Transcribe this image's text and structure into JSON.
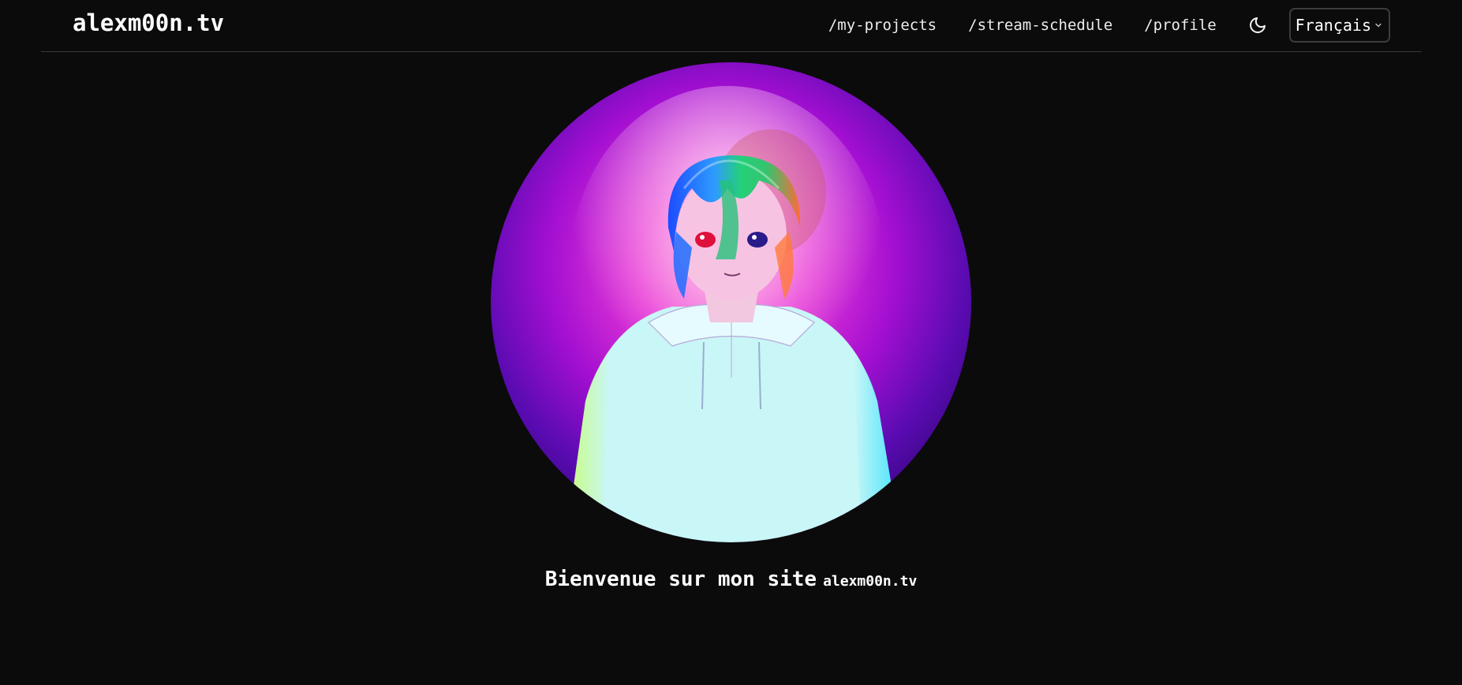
{
  "header": {
    "brand": "alexm00n.tv",
    "nav": [
      {
        "label": "/my-projects"
      },
      {
        "label": "/stream-schedule"
      },
      {
        "label": "/profile"
      }
    ],
    "theme_toggle_icon": "moon-icon",
    "language": {
      "selected": "Français",
      "icon": "chevron-down-icon"
    }
  },
  "hero": {
    "avatar_icon": "avatar-illustration",
    "welcome_text": "Bienvenue sur mon site",
    "welcome_brand": "alexm00n.tv"
  },
  "colors": {
    "background": "#0b0b0b",
    "text": "#ffffff",
    "divider": "#3a3a3a"
  }
}
